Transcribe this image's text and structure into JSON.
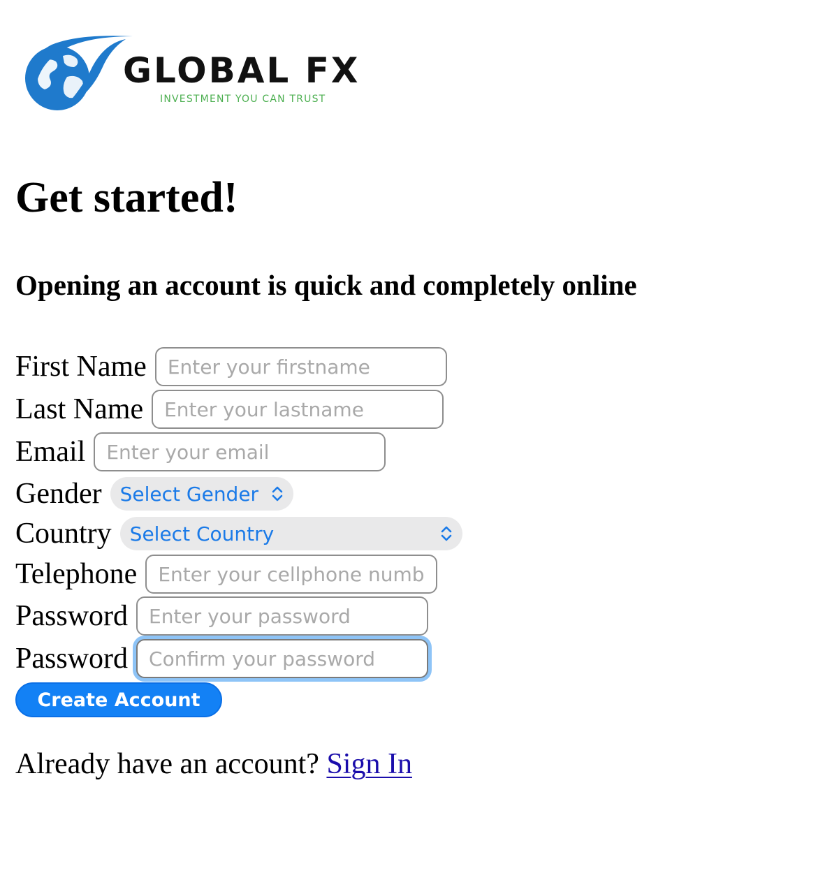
{
  "brand": {
    "name": "GLOBAL FX",
    "tagline": "INVESTMENT YOU CAN TRUST",
    "logo_icon": "globe-icon",
    "colors": {
      "globe": "#1f7acc",
      "tagline": "#4caf50"
    }
  },
  "page": {
    "title": "Get started!",
    "subtitle": "Opening an account is quick and completely online"
  },
  "form": {
    "first_name": {
      "label": "First Name",
      "placeholder": "Enter your firstname",
      "value": ""
    },
    "last_name": {
      "label": "Last Name",
      "placeholder": "Enter your lastname",
      "value": ""
    },
    "email": {
      "label": "Email",
      "placeholder": "Enter your email",
      "value": ""
    },
    "gender": {
      "label": "Gender",
      "selected": "Select Gender"
    },
    "country": {
      "label": "Country",
      "selected": "Select Country"
    },
    "telephone": {
      "label": "Telephone",
      "placeholder": "Enter your cellphone numb",
      "value": ""
    },
    "password": {
      "label": "Password",
      "placeholder": "Enter your password",
      "value": ""
    },
    "confirm_password": {
      "label": "Password",
      "placeholder": "Confirm your password",
      "value": "",
      "focused": true
    },
    "submit_label": "Create Account"
  },
  "footer": {
    "prompt": "Already have an account?",
    "signin_label": "Sign In"
  },
  "colors": {
    "accent": "#1381f5",
    "select_text": "#1a7ae8",
    "link": "#1a0dab",
    "focus_ring": "#8ec4f7"
  }
}
